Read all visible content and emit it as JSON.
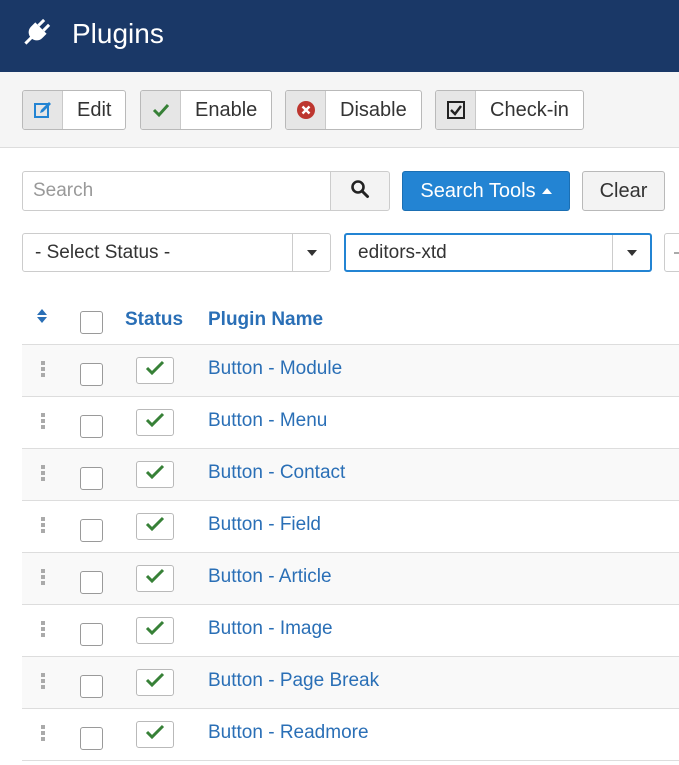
{
  "header": {
    "title": "Plugins",
    "icon": "plug-icon"
  },
  "toolbar": {
    "buttons": [
      {
        "label": "Edit",
        "icon": "edit-icon"
      },
      {
        "label": "Enable",
        "icon": "check-icon"
      },
      {
        "label": "Disable",
        "icon": "times-circle-icon"
      },
      {
        "label": "Check-in",
        "icon": "checkbox-icon"
      }
    ]
  },
  "search": {
    "placeholder": "Search",
    "tools_label": "Search Tools",
    "clear_label": "Clear"
  },
  "filters": {
    "status": "- Select Status -",
    "folder": "editors-xtd"
  },
  "table": {
    "headers": {
      "status": "Status",
      "name": "Plugin Name"
    },
    "rows": [
      {
        "name": "Button - Module",
        "enabled": true
      },
      {
        "name": "Button - Menu",
        "enabled": true
      },
      {
        "name": "Button - Contact",
        "enabled": true
      },
      {
        "name": "Button - Field",
        "enabled": true
      },
      {
        "name": "Button - Article",
        "enabled": true
      },
      {
        "name": "Button - Image",
        "enabled": true
      },
      {
        "name": "Button - Page Break",
        "enabled": true
      },
      {
        "name": "Button - Readmore",
        "enabled": true
      }
    ]
  },
  "colors": {
    "header_bg": "#1a3867",
    "primary": "#2384d3",
    "link": "#2a6fb6",
    "success": "#378137",
    "danger": "#bd362f"
  }
}
